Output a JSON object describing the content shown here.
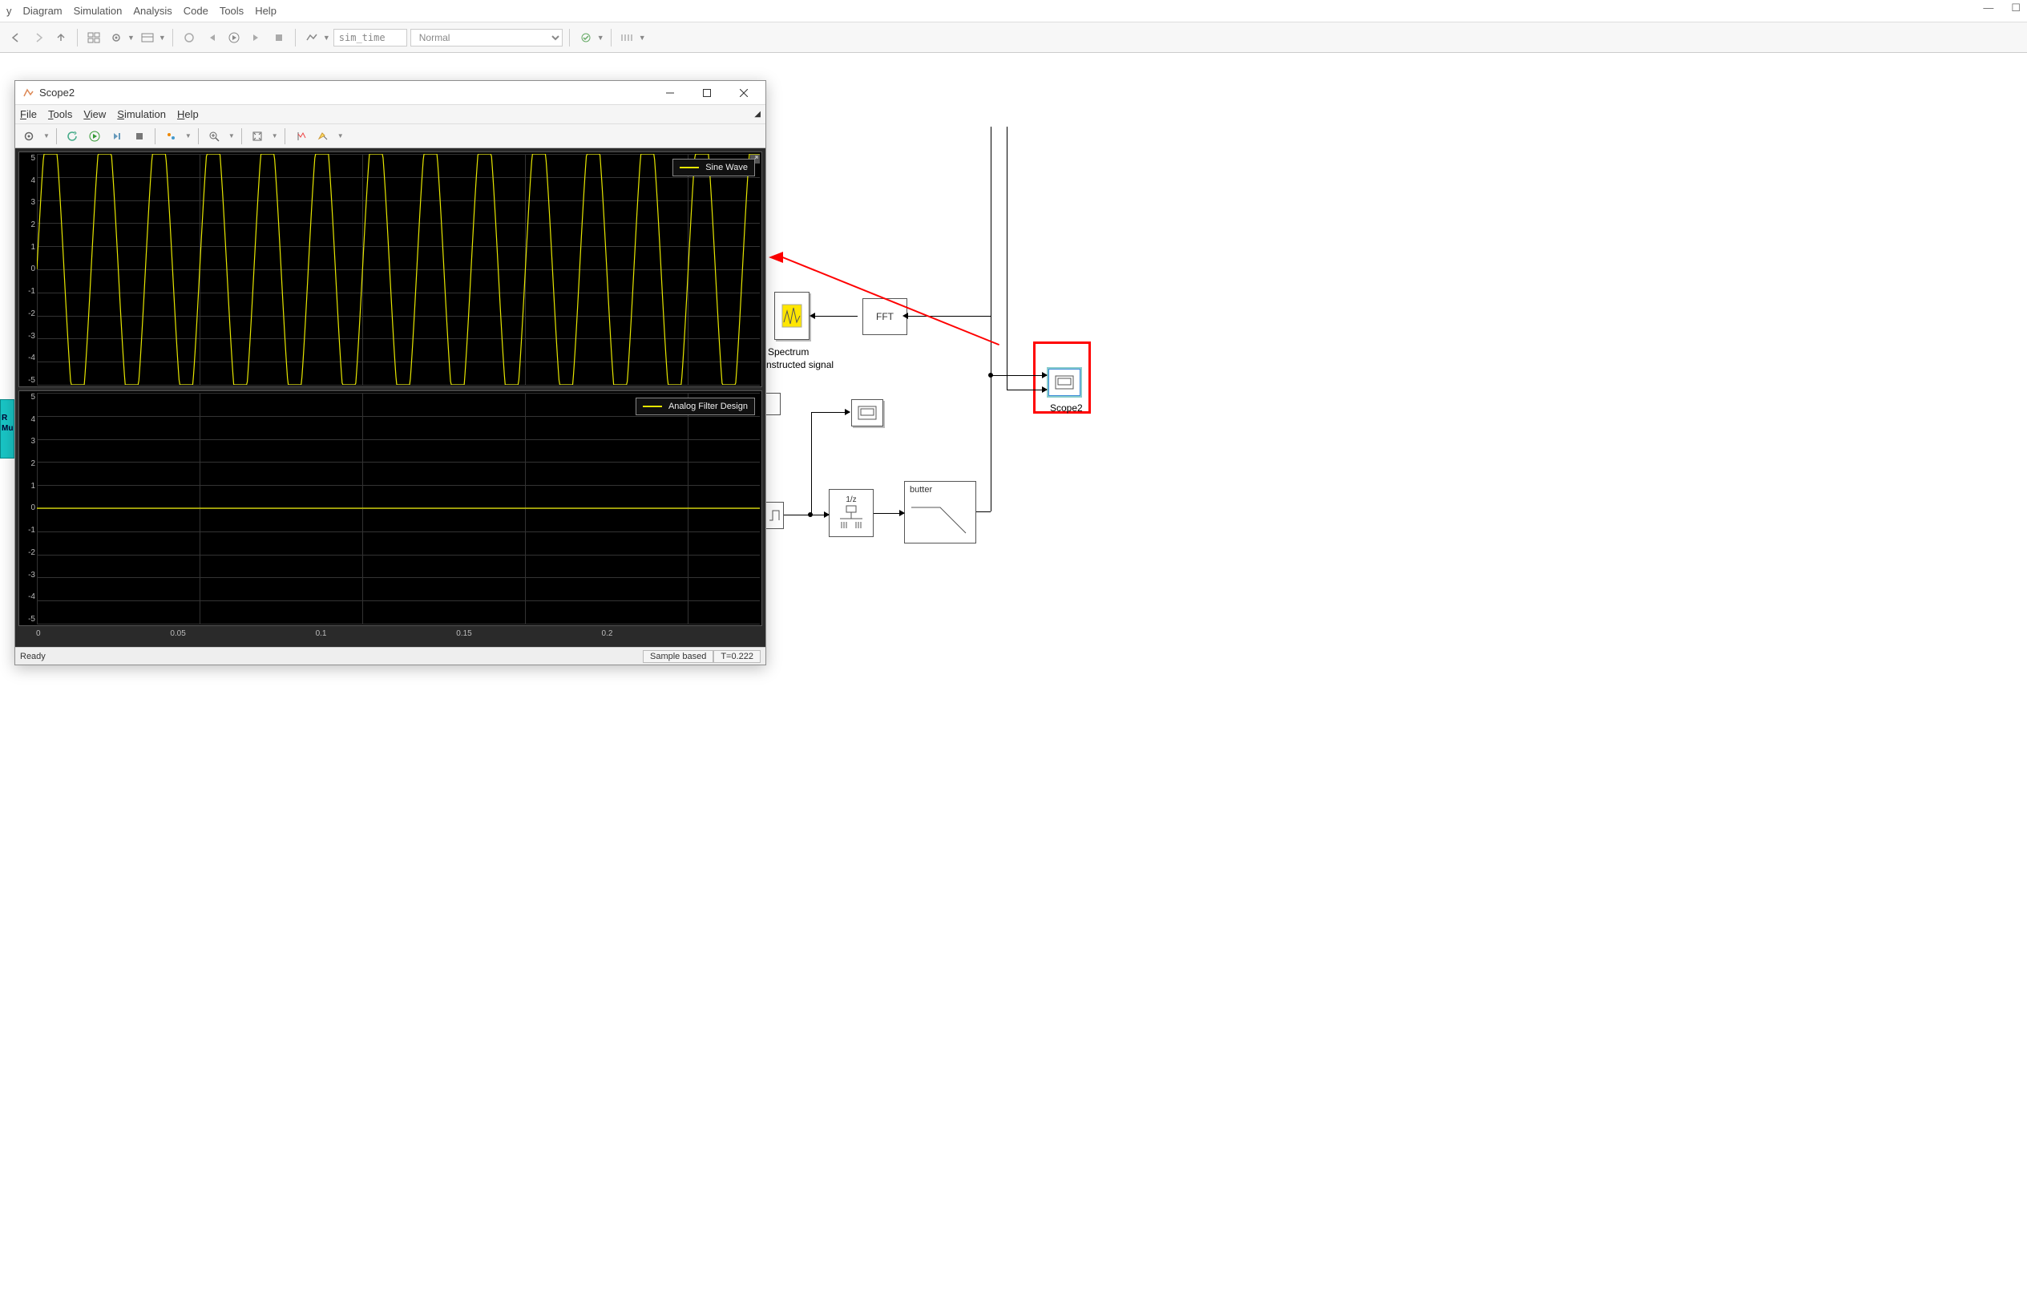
{
  "main_menu": {
    "y": "y",
    "diagram": "Diagram",
    "simulation": "Simulation",
    "analysis": "Analysis",
    "code": "Code",
    "tools": "Tools",
    "help": "Help"
  },
  "main_toolbar": {
    "sim_time": "sim_time",
    "mode": "Normal"
  },
  "scope": {
    "title": "Scope2",
    "menu": {
      "file": "File",
      "tools": "Tools",
      "view": "View",
      "simulation": "Simulation",
      "help": "Help"
    },
    "legend1": "Sine Wave",
    "legend2": "Analog Filter Design",
    "status_left": "Ready",
    "status_mode": "Sample based",
    "status_time": "T=0.222"
  },
  "chart_data": [
    {
      "type": "line",
      "title": "",
      "xlabel": "",
      "ylabel": "",
      "xlim": [
        0,
        0.222
      ],
      "ylim": [
        -5,
        5
      ],
      "yticks": [
        5,
        4,
        3,
        2,
        1,
        0,
        -1,
        -2,
        -3,
        -4,
        -5
      ],
      "xticks": [
        0,
        0.05,
        0.1,
        0.15,
        0.2
      ],
      "series": [
        {
          "name": "Sine Wave",
          "note": "≈60 Hz sine, amplitude 5, clipped at ±5; ~13 cycles visible over 0–0.222 s"
        }
      ]
    },
    {
      "type": "line",
      "title": "",
      "xlabel": "",
      "ylabel": "",
      "xlim": [
        0,
        0.222
      ],
      "ylim": [
        -5,
        5
      ],
      "yticks": [
        5,
        4,
        3,
        2,
        1,
        0,
        -1,
        -2,
        -3,
        -4,
        -5
      ],
      "xticks": [
        0,
        0.05,
        0.1,
        0.15,
        0.2
      ],
      "series": [
        {
          "name": "Analog Filter Design",
          "note": "flat line at y=0"
        }
      ]
    }
  ],
  "blocks": {
    "fft": "FFT",
    "spectrum1": "Spectrum",
    "spectrum2": "nstructed signal",
    "scope2": "Scope2",
    "unitdelay": "1/z",
    "butter": "butter"
  }
}
